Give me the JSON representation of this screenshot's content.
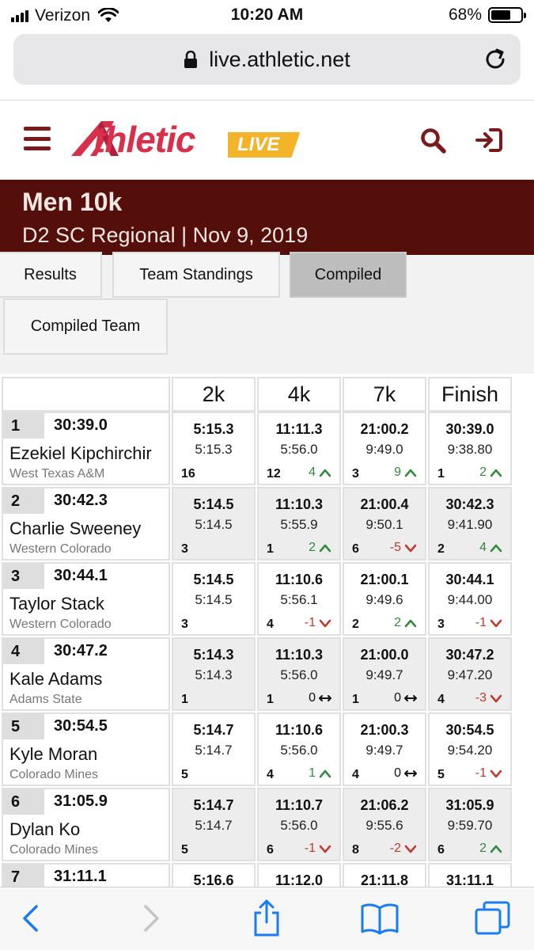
{
  "status_bar": {
    "carrier": "Verizon",
    "time": "10:20 AM",
    "battery": "68%",
    "battery_level": 0.68
  },
  "browser": {
    "url": "live.athletic.net"
  },
  "app": {
    "logo_main": "thletic",
    "logo_badge": "LIVE"
  },
  "event": {
    "title": "Men 10k",
    "subtitle": "D2 SC Regional | Nov 9, 2019"
  },
  "tabs": [
    {
      "label": "Results",
      "active": false
    },
    {
      "label": "Team Standings",
      "active": false
    },
    {
      "label": "Compiled",
      "active": true
    },
    {
      "label": "Compiled Team",
      "active": false
    }
  ],
  "columns": [
    "2k",
    "4k",
    "7k",
    "Finish"
  ],
  "rows": [
    {
      "place": "1",
      "time": "30:39.0",
      "name": "Ezekiel Kipchirchir",
      "school": "West Texas A&M",
      "splits": [
        {
          "cum": "5:15.3",
          "split": "5:15.3",
          "rank": "16",
          "chg": "",
          "dir": ""
        },
        {
          "cum": "11:11.3",
          "split": "5:56.0",
          "rank": "12",
          "chg": "4",
          "dir": "up"
        },
        {
          "cum": "21:00.2",
          "split": "9:49.0",
          "rank": "3",
          "chg": "9",
          "dir": "up"
        },
        {
          "cum": "30:39.0",
          "split": "9:38.80",
          "rank": "1",
          "chg": "2",
          "dir": "up"
        }
      ]
    },
    {
      "place": "2",
      "time": "30:42.3",
      "name": "Charlie Sweeney",
      "school": "Western Colorado",
      "splits": [
        {
          "cum": "5:14.5",
          "split": "5:14.5",
          "rank": "3",
          "chg": "",
          "dir": ""
        },
        {
          "cum": "11:10.3",
          "split": "5:55.9",
          "rank": "1",
          "chg": "2",
          "dir": "up"
        },
        {
          "cum": "21:00.4",
          "split": "9:50.1",
          "rank": "6",
          "chg": "-5",
          "dir": "down"
        },
        {
          "cum": "30:42.3",
          "split": "9:41.90",
          "rank": "2",
          "chg": "4",
          "dir": "up"
        }
      ]
    },
    {
      "place": "3",
      "time": "30:44.1",
      "name": "Taylor Stack",
      "school": "Western Colorado",
      "splits": [
        {
          "cum": "5:14.5",
          "split": "5:14.5",
          "rank": "3",
          "chg": "",
          "dir": ""
        },
        {
          "cum": "11:10.6",
          "split": "5:56.1",
          "rank": "4",
          "chg": "-1",
          "dir": "down"
        },
        {
          "cum": "21:00.1",
          "split": "9:49.6",
          "rank": "2",
          "chg": "2",
          "dir": "up"
        },
        {
          "cum": "30:44.1",
          "split": "9:44.00",
          "rank": "3",
          "chg": "-1",
          "dir": "down"
        }
      ]
    },
    {
      "place": "4",
      "time": "30:47.2",
      "name": "Kale Adams",
      "school": "Adams State",
      "splits": [
        {
          "cum": "5:14.3",
          "split": "5:14.3",
          "rank": "1",
          "chg": "",
          "dir": ""
        },
        {
          "cum": "11:10.3",
          "split": "5:56.0",
          "rank": "1",
          "chg": "0",
          "dir": "same"
        },
        {
          "cum": "21:00.0",
          "split": "9:49.7",
          "rank": "1",
          "chg": "0",
          "dir": "same"
        },
        {
          "cum": "30:47.2",
          "split": "9:47.20",
          "rank": "4",
          "chg": "-3",
          "dir": "down"
        }
      ]
    },
    {
      "place": "5",
      "time": "30:54.5",
      "name": "Kyle Moran",
      "school": "Colorado Mines",
      "splits": [
        {
          "cum": "5:14.7",
          "split": "5:14.7",
          "rank": "5",
          "chg": "",
          "dir": ""
        },
        {
          "cum": "11:10.6",
          "split": "5:56.0",
          "rank": "4",
          "chg": "1",
          "dir": "up"
        },
        {
          "cum": "21:00.3",
          "split": "9:49.7",
          "rank": "4",
          "chg": "0",
          "dir": "same"
        },
        {
          "cum": "30:54.5",
          "split": "9:54.20",
          "rank": "5",
          "chg": "-1",
          "dir": "down"
        }
      ]
    },
    {
      "place": "6",
      "time": "31:05.9",
      "name": "Dylan Ko",
      "school": "Colorado Mines",
      "splits": [
        {
          "cum": "5:14.7",
          "split": "5:14.7",
          "rank": "5",
          "chg": "",
          "dir": ""
        },
        {
          "cum": "11:10.7",
          "split": "5:56.0",
          "rank": "6",
          "chg": "-1",
          "dir": "down"
        },
        {
          "cum": "21:06.2",
          "split": "9:55.6",
          "rank": "8",
          "chg": "-2",
          "dir": "down"
        },
        {
          "cum": "31:05.9",
          "split": "9:59.70",
          "rank": "6",
          "chg": "2",
          "dir": "up"
        }
      ]
    },
    {
      "place": "7",
      "time": "31:11.1",
      "name": "",
      "school": "",
      "splits": [
        {
          "cum": "5:16.6",
          "split": "",
          "rank": "",
          "chg": "",
          "dir": ""
        },
        {
          "cum": "11:12.0",
          "split": "",
          "rank": "",
          "chg": "",
          "dir": ""
        },
        {
          "cum": "21:11.8",
          "split": "",
          "rank": "",
          "chg": "",
          "dir": ""
        },
        {
          "cum": "31:11.1",
          "split": "",
          "rank": "",
          "chg": "",
          "dir": ""
        }
      ]
    }
  ],
  "colors": {
    "brand_dark": "#540f0a",
    "logo_red": "#d8304a",
    "live_orange": "#f4b42a",
    "up_green": "#2f8a3a",
    "down_red": "#c0392b",
    "ios_blue": "#1a7cf5"
  }
}
